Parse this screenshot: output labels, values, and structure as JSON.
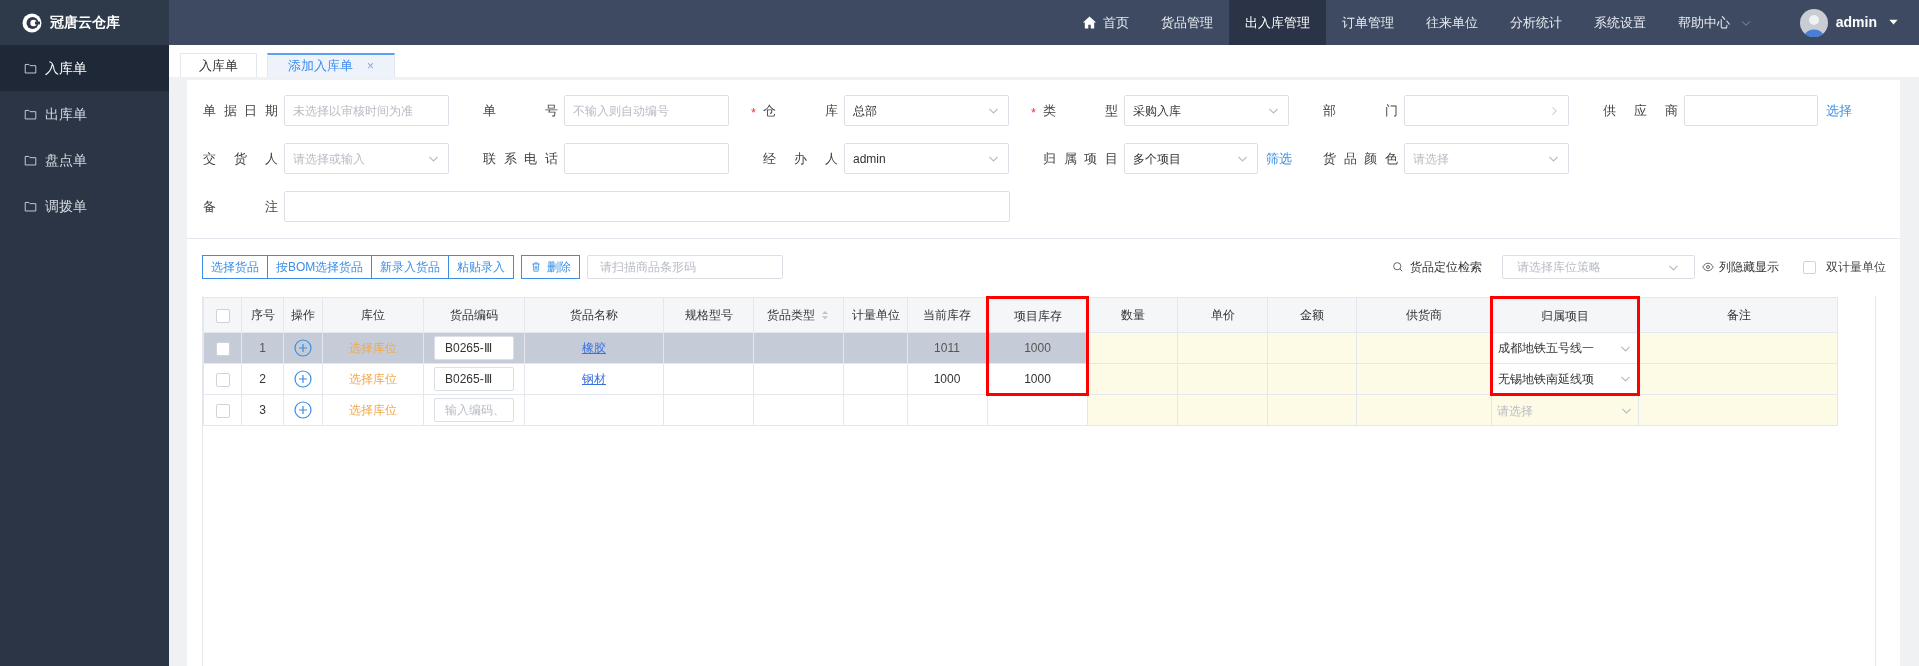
{
  "app_title": "冠唐云仓库",
  "top_nav": [
    {
      "label": "首页",
      "kind": "home",
      "selected": false
    },
    {
      "label": "货品管理",
      "selected": false
    },
    {
      "label": "出入库管理",
      "selected": true
    },
    {
      "label": "订单管理",
      "selected": false
    },
    {
      "label": "往来单位",
      "selected": false
    },
    {
      "label": "分析统计",
      "selected": false
    },
    {
      "label": "系统设置",
      "selected": false
    },
    {
      "label": "帮助中心",
      "selected": false,
      "dropdown": true
    }
  ],
  "user": {
    "name": "admin"
  },
  "sidebar": [
    {
      "label": "入库单",
      "selected": true
    },
    {
      "label": "出库单",
      "selected": false
    },
    {
      "label": "盘点单",
      "selected": false
    },
    {
      "label": "调拨单",
      "selected": false
    }
  ],
  "tabs": [
    {
      "label": "入库单",
      "selected": false
    },
    {
      "label": "添加入库单",
      "selected": true,
      "close": "×"
    }
  ],
  "form": [
    [
      {
        "label": "单据日期",
        "kind": "text",
        "placeholder": "未选择以审核时间为准"
      },
      {
        "label": "单号",
        "kind": "text",
        "placeholder": "不输入则自动编号"
      },
      {
        "label": "仓库",
        "required_mark": "*",
        "kind": "select",
        "value": "总部"
      },
      {
        "label": "类型",
        "required_mark": "*",
        "kind": "select",
        "value": "采购入库"
      },
      {
        "label": "部门",
        "kind": "cascader"
      },
      {
        "label": "供应商",
        "kind": "text",
        "link": "选择"
      }
    ],
    [
      {
        "label": "交货人",
        "kind": "select",
        "placeholder": "请选择或输入"
      },
      {
        "label": "联系电话",
        "kind": "text"
      },
      {
        "label": "经办人",
        "kind": "select",
        "value": "admin"
      },
      {
        "label": "归属项目",
        "kind": "select",
        "value": "多个项目",
        "link": "筛选"
      },
      {
        "label": "货品颜色",
        "kind": "select",
        "placeholder": "请选择"
      }
    ],
    [
      {
        "label": "备注",
        "kind": "text",
        "wide": true
      }
    ]
  ],
  "toolbar": {
    "button_group": [
      "选择货品",
      "按BOM选择货品",
      "新录入货品",
      "粘贴录入"
    ],
    "delete_button": "删除",
    "barcode_placeholder": "请扫描商品条形码",
    "locate_link": "货品定位检索",
    "strategy_placeholder": "请选择库位策略",
    "column_toggle": "列隐藏显示",
    "dual_unit": {
      "label": "双计量单位",
      "checked": false
    }
  },
  "table": {
    "columns": [
      {
        "kind": "checkbox",
        "checked": false
      },
      {
        "label": "序号",
        "kind": "index"
      },
      {
        "label": "操作",
        "kind": "action"
      },
      {
        "label": "库位",
        "kind": "location"
      },
      {
        "label": "货品编码",
        "kind": "code"
      },
      {
        "label": "货品名称",
        "kind": "name"
      },
      {
        "label": "规格型号",
        "kind": "text"
      },
      {
        "label": "货品类型",
        "kind": "text",
        "sortable": true
      },
      {
        "label": "计量单位",
        "kind": "text"
      },
      {
        "label": "当前库存",
        "kind": "text"
      },
      {
        "label": "项目库存",
        "kind": "text",
        "highlighted": true
      },
      {
        "label": "数量",
        "kind": "text",
        "editable": true
      },
      {
        "label": "单价",
        "kind": "text",
        "editable": true
      },
      {
        "label": "金额",
        "kind": "text",
        "editable": true
      },
      {
        "label": "供货商",
        "kind": "text",
        "editable": true
      },
      {
        "label": "归属项目",
        "kind": "select",
        "editable": true,
        "highlighted": true
      },
      {
        "label": "备注",
        "kind": "text",
        "editable": true
      }
    ],
    "rows": [
      {
        "selected": true,
        "highlighted": true,
        "cells": [
          {
            "checked": false
          },
          {
            "text": "1"
          },
          {},
          {
            "text": "选择库位"
          },
          {
            "text": "B0265-Ⅲ"
          },
          {
            "text": "橡胶"
          },
          {},
          {},
          {},
          {
            "text": "1011"
          },
          {
            "text": "1000"
          },
          {},
          {},
          {},
          {},
          {
            "text": "成都地铁五号线一"
          },
          {}
        ]
      },
      {
        "selected": false,
        "highlighted": true,
        "cells": [
          {
            "checked": false
          },
          {
            "text": "2"
          },
          {},
          {
            "text": "选择库位"
          },
          {
            "text": "B0265-Ⅲ"
          },
          {
            "text": "钢材"
          },
          {},
          {},
          {},
          {
            "text": "1000"
          },
          {
            "text": "1000"
          },
          {},
          {},
          {},
          {},
          {
            "text": "无锡地铁南延线项"
          },
          {}
        ]
      },
      {
        "selected": false,
        "highlighted": false,
        "cells": [
          {
            "checked": false
          },
          {
            "text": "3"
          },
          {},
          {
            "text": "选择库位"
          },
          {
            "placeholder": "输入编码、"
          },
          {},
          {},
          {},
          {},
          {},
          {},
          {},
          {},
          {},
          {},
          {
            "placeholder": "请选择"
          },
          {}
        ]
      }
    ]
  }
}
